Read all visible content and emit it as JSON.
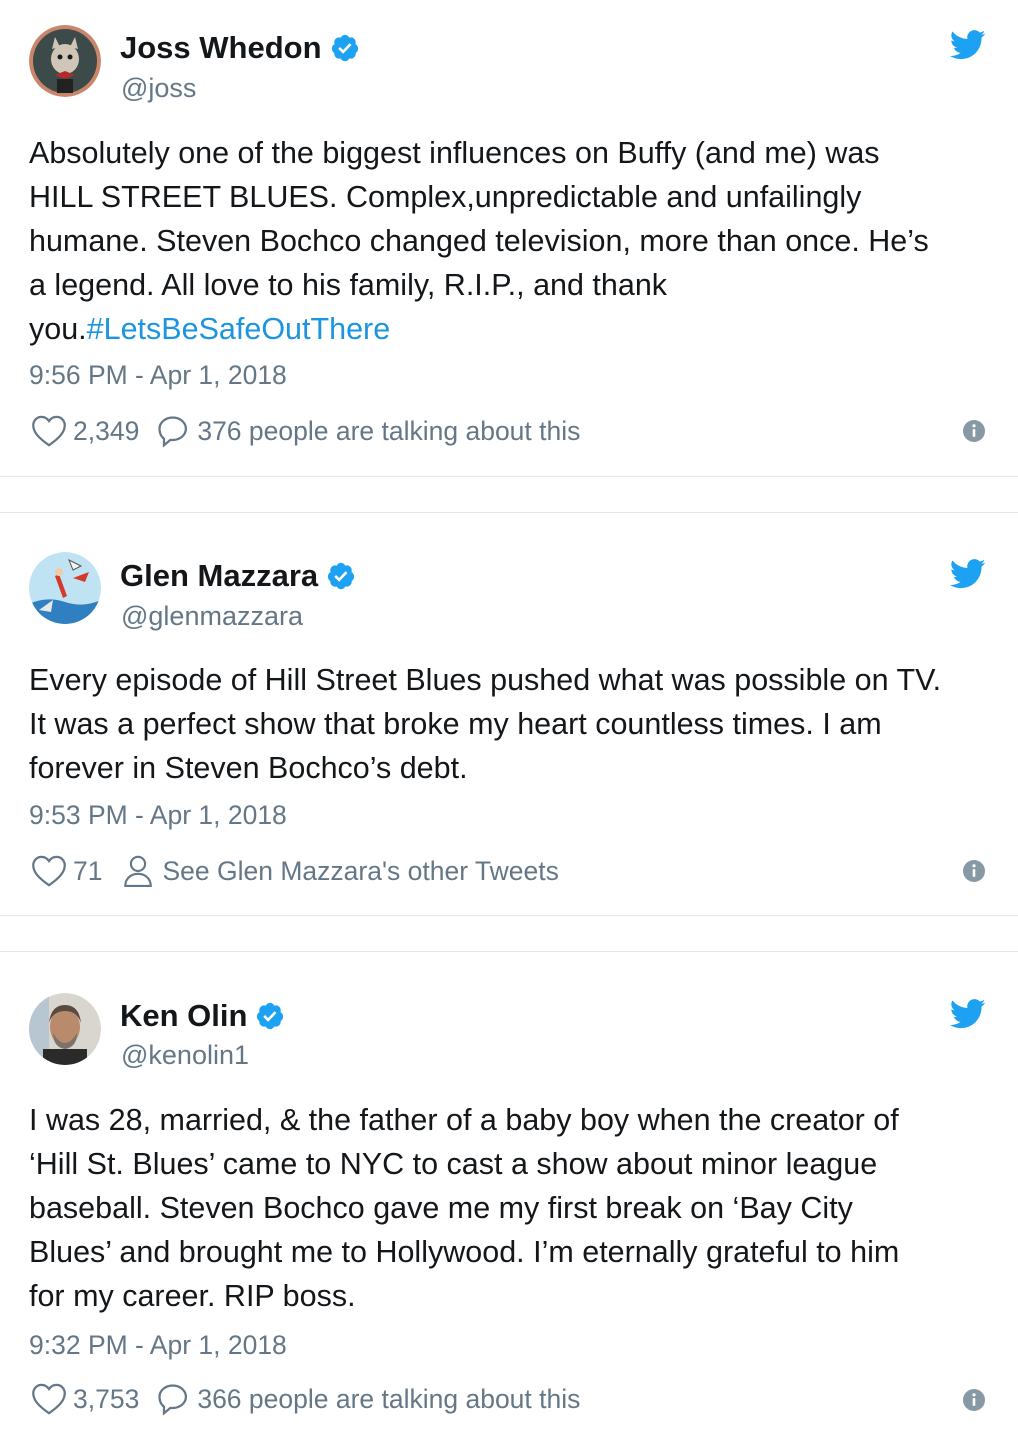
{
  "colors": {
    "verified": "#1da1f2",
    "link": "#1b95e0",
    "muted": "#657786",
    "border": "#e1e8ed",
    "text": "#14171a"
  },
  "tweets": [
    {
      "name": "Joss Whedon",
      "handle": "@joss",
      "text": "Absolutely one of the biggest influences on Buffy (and me) was\nHILL STREET BLUES. Complex,unpredictable and unfailingly\nhumane. Steven Bochco changed television, more than once. He’s\na legend. All love to his family,  R.I.P., and thank\nyou.",
      "hashtag": "#LetsBeSafeOutThere",
      "time": "9:56 PM - Apr 1, 2018",
      "likes": "2,349",
      "secondary_action": "376 people are talking about this",
      "secondary_icon": "reply-bubble-icon"
    },
    {
      "name": "Glen Mazzara",
      "handle": "@glenmazzara",
      "text": "Every episode of Hill Street Blues pushed what was possible on TV.\nIt was a perfect show that broke my heart countless times. I am\nforever in Steven Bochco’s debt.",
      "time": "9:53 PM - Apr 1, 2018",
      "likes": "71",
      "secondary_action": "See Glen Mazzara's other Tweets",
      "secondary_icon": "person-icon"
    },
    {
      "name": "Ken Olin",
      "handle": "@kenolin1",
      "text": "I was 28, married, & the father of a baby boy when the creator of\n‘Hill St. Blues’ came to NYC to cast a show about minor league\nbaseball. Steven Bochco gave me my first break on ‘Bay City\nBlues’ and brought me to Hollywood. I’m eternally grateful to him\nfor my career. RIP boss.",
      "time": "9:32 PM - Apr 1, 2018",
      "likes": "3,753",
      "secondary_action": "366 people are talking about this",
      "secondary_icon": "reply-bubble-icon"
    }
  ]
}
